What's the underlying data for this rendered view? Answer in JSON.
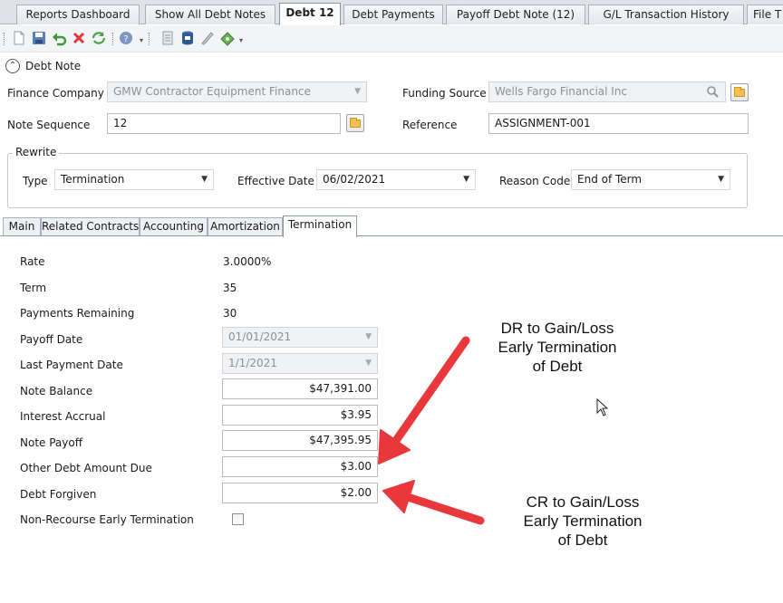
{
  "tabs": [
    {
      "label": "Reports Dashboard",
      "active": false
    },
    {
      "label": "Show All Debt Notes",
      "active": false
    },
    {
      "label": "Debt 12",
      "active": true
    },
    {
      "label": "Debt Payments",
      "active": false
    },
    {
      "label": "Payoff Debt Note (12)",
      "active": false
    },
    {
      "label": "G/L Transaction History",
      "active": false
    },
    {
      "label": "File T",
      "active": false
    }
  ],
  "toolbar": {
    "icons": [
      "new-icon",
      "save-icon",
      "undo-icon",
      "delete-icon",
      "refresh-icon",
      "help-icon",
      "notes-icon",
      "database-icon",
      "pen-icon",
      "money-icon"
    ]
  },
  "section": {
    "title": "Debt Note"
  },
  "header_form": {
    "finance_company_label": "Finance Company",
    "finance_company_value": "GMW Contractor Equipment Finance",
    "funding_source_label": "Funding Source",
    "funding_source_value": "Wells Fargo Financial Inc",
    "note_sequence_label": "Note Sequence",
    "note_sequence_value": "12",
    "reference_label": "Reference",
    "reference_value": "ASSIGNMENT-001"
  },
  "rewrite": {
    "legend": "Rewrite",
    "type_label": "Type",
    "type_value": "Termination",
    "effective_date_label": "Effective Date",
    "effective_date_value": "06/02/2021",
    "reason_code_label": "Reason Code",
    "reason_code_value": "End of Term"
  },
  "inner_tabs": [
    {
      "label": "Main",
      "active": false
    },
    {
      "label": "Related Contracts",
      "active": false
    },
    {
      "label": "Accounting",
      "active": false
    },
    {
      "label": "Amortization",
      "active": false
    },
    {
      "label": "Termination",
      "active": true
    }
  ],
  "termination": {
    "rate_label": "Rate",
    "rate_value": "3.0000%",
    "term_label": "Term",
    "term_value": "35",
    "payments_remaining_label": "Payments Remaining",
    "payments_remaining_value": "30",
    "payoff_date_label": "Payoff Date",
    "payoff_date_value": "01/01/2021",
    "last_payment_date_label": "Last Payment Date",
    "last_payment_date_value": "1/1/2021",
    "note_balance_label": "Note Balance",
    "note_balance_value": "$47,391.00",
    "interest_accrual_label": "Interest Accrual",
    "interest_accrual_value": "$3.95",
    "note_payoff_label": "Note Payoff",
    "note_payoff_value": "$47,395.95",
    "other_debt_label": "Other Debt Amount Due",
    "other_debt_value": "$3.00",
    "debt_forgiven_label": "Debt Forgiven",
    "debt_forgiven_value": "$2.00",
    "non_recourse_label": "Non-Recourse Early Termination",
    "non_recourse_checked": false
  },
  "annotations": {
    "dr_line1": "DR to Gain/Loss",
    "dr_line2": "Early Termination",
    "dr_line3": "of Debt",
    "cr_line1": "CR to Gain/Loss",
    "cr_line2": "Early Termination",
    "cr_line3": "of Debt",
    "arrow_color": "#e8383b"
  }
}
